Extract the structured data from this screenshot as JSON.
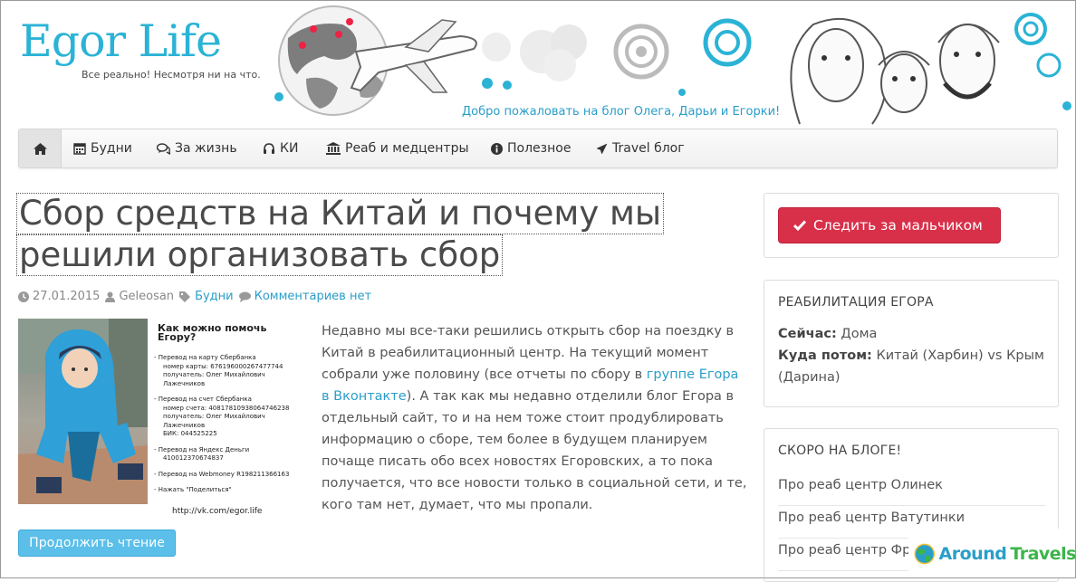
{
  "header": {
    "logo_title": "Egor Life",
    "logo_tagline": "Все реально! Несмотря ни на что.",
    "welcome": "Добро пожаловать на блог  Олега, Дарьи и Егорки!"
  },
  "nav": {
    "home_icon": "home-icon",
    "items": [
      {
        "label": "Будни",
        "icon": "calendar-icon"
      },
      {
        "label": "За жизнь",
        "icon": "comments-icon"
      },
      {
        "label": "КИ",
        "icon": "headphones-icon"
      },
      {
        "label": "Реаб и медцентры",
        "icon": "institution-icon"
      },
      {
        "label": "Полезное",
        "icon": "info-icon"
      },
      {
        "label": "Travel блог",
        "icon": "plane-icon"
      }
    ]
  },
  "post": {
    "title_line1": "Сбор средств на Китай и почему мы",
    "title_line2": "решили организовать сбор",
    "date": "27.01.2015",
    "author": "Geleosan",
    "category": "Будни",
    "comments": "Комментариев нет",
    "thumbnail": {
      "title": "Как можно помочь Егору?",
      "blocks": [
        [
          "- Перевод на карту Сбербанка",
          "номер карты: 676196000267477744",
          "получатель: Олег Михайлович Лажечников"
        ],
        [
          "- Перевод на счет Сбербанка",
          "номер счета: 40817810938064746238",
          "получатель: Олег Михайлович Лажечников",
          "БИК: 044525225"
        ],
        [
          "- Перевод на Яндекс Деньги",
          "410012370674837"
        ],
        [
          "- Перевод на Webmoney R198211366163"
        ],
        [
          "- Нажать \"Поделиться\""
        ]
      ],
      "url": "http://vk.com/egor.life"
    },
    "excerpt_part1": "Недавно мы все-таки решились открыть сбор на поездку в Китай в реабилитационный центр. На текущий момент собрали уже половину (все отчеты по сбору в ",
    "excerpt_link": "группе Егора в Вконтакте",
    "excerpt_part2": "). А так как мы недавно отделили блог Егора в отдельный сайт, то и на нем тоже стоит продублировать информацию о сборе, тем более в будущем планируем почаще писать обо всех новостях Егоровских, а то пока получается, что все новости только в социальной сети, и те, кого там нет, думает, что мы пропали.",
    "read_more": "Продолжить чтение"
  },
  "sidebar": {
    "follow_button": "Следить за мальчиком",
    "rehab": {
      "title": "РЕАБИЛИТАЦИЯ ЕГОРА",
      "now_label": "Сейчас:",
      "now_value": " Дома",
      "next_label": "Куда потом:",
      "next_value": " Китай (Харбин) vs Крым (Дарина)"
    },
    "soon": {
      "title": "СКОРО НА БЛОГЕ!",
      "items": [
        "Про реаб центр Олинек",
        "Про реаб центр Ватутинки",
        "Про реаб центр Фря"
      ]
    }
  },
  "watermark": {
    "text1": "Around",
    "text2": "Travels"
  },
  "colors": {
    "accent": "#2bb3d6",
    "link": "#2a9ec9",
    "follow": "#d9304a",
    "read_more": "#5bbfe9"
  }
}
